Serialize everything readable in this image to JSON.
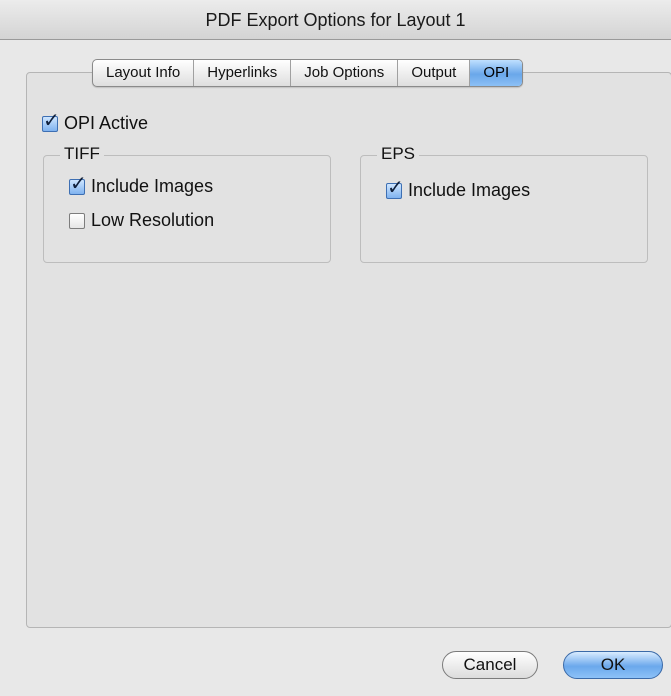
{
  "window": {
    "title": "PDF Export Options for Layout 1"
  },
  "tabs": [
    {
      "label": "Layout Info",
      "active": false
    },
    {
      "label": "Hyperlinks",
      "active": false
    },
    {
      "label": "Job Options",
      "active": false
    },
    {
      "label": "Output",
      "active": false
    },
    {
      "label": "OPI",
      "active": true
    }
  ],
  "opi": {
    "active_label": "OPI Active",
    "active_checked": true,
    "tiff": {
      "title": "TIFF",
      "include_images_label": "Include Images",
      "include_images_checked": true,
      "low_resolution_label": "Low Resolution",
      "low_resolution_checked": false
    },
    "eps": {
      "title": "EPS",
      "include_images_label": "Include Images",
      "include_images_checked": true
    }
  },
  "buttons": {
    "cancel": "Cancel",
    "ok": "OK"
  },
  "icons": {
    "check": "checkmark-icon"
  },
  "colors": {
    "accent": "#6aa7ea"
  }
}
